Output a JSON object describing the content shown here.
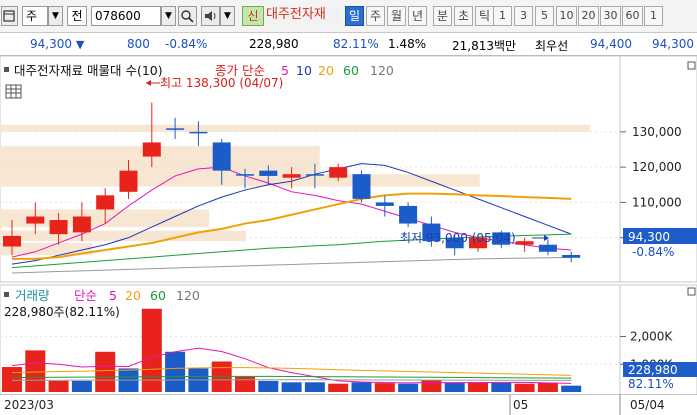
{
  "toolbar": {
    "market_type": "주",
    "prev_label": "전",
    "stock_code": "078600",
    "badge_new": "신",
    "stock_name": "대주전자재",
    "periods": [
      "일",
      "주",
      "월",
      "년",
      "분",
      "초",
      "틱"
    ],
    "active_period": "일",
    "intervals": [
      "1",
      "3",
      "5",
      "10",
      "20",
      "30",
      "60",
      "1"
    ]
  },
  "infobar": {
    "price": "94,300",
    "change": "800",
    "change_pct": "-0.84%",
    "volume": "228,980",
    "vol_ratio": "82.11%",
    "turnover": "1.48%",
    "amount": "21,813백만",
    "best_label": "최우선",
    "ask": "94,400",
    "bid": "94,300"
  },
  "colors": {
    "up": "#e8231b",
    "down": "#1c5cc8",
    "ma5": "#e316b6",
    "ma10": "#1d35b8",
    "ma20": "#f0a10a",
    "ma60": "#1e9b36",
    "ma120": "#9a9a9a",
    "profile": "#f7e7d2",
    "price_label_bg": "#1f5cc9"
  },
  "price_panel": {
    "title": "대주전자재료 매물대 수(10)",
    "ma_prefix": "종가 단순",
    "ma_labels": [
      "5",
      "10",
      "20",
      "60",
      "120"
    ],
    "high_annotation": "최고 138,300 (04/07)",
    "low_annotation": "최저 93,000 (05/04)",
    "current_price_label": "94,300",
    "current_change_label": "-0.84%",
    "axis_ticks": [
      "130,000",
      "120,000",
      "110,000",
      "100,000"
    ]
  },
  "volume_panel": {
    "title": "거래량",
    "ma_prefix": "단순",
    "ma_labels": [
      "5",
      "20",
      "60",
      "120"
    ],
    "current_info": "228,980주(82.11%)",
    "axis_ticks": [
      "2,000K",
      "1,000K"
    ],
    "current_volume_label": "228,980",
    "current_ratio_label": "82.11%"
  },
  "date_axis": {
    "labels": [
      "2023/03",
      "05",
      "05/04"
    ]
  },
  "chart_data": {
    "type": "candlestick",
    "ylim": [
      88000,
      143000
    ],
    "candles": [
      {
        "o": 97500,
        "h": 105000,
        "l": 95000,
        "c": 100500
      },
      {
        "o": 104000,
        "h": 110000,
        "l": 101000,
        "c": 106000
      },
      {
        "o": 101000,
        "h": 107000,
        "l": 98000,
        "c": 105000
      },
      {
        "o": 101500,
        "h": 110000,
        "l": 99000,
        "c": 106000
      },
      {
        "o": 108000,
        "h": 114000,
        "l": 104000,
        "c": 112000
      },
      {
        "o": 113000,
        "h": 122000,
        "l": 111000,
        "c": 119000
      },
      {
        "o": 123000,
        "h": 138300,
        "l": 120000,
        "c": 127000
      },
      {
        "o": 131000,
        "h": 134000,
        "l": 128000,
        "c": 131000
      },
      {
        "o": 130000,
        "h": 133000,
        "l": 126000,
        "c": 130000
      },
      {
        "o": 127000,
        "h": 128000,
        "l": 115000,
        "c": 119000
      },
      {
        "o": 118000,
        "h": 119500,
        "l": 114000,
        "c": 118000
      },
      {
        "o": 119000,
        "h": 120500,
        "l": 115000,
        "c": 117500
      },
      {
        "o": 117000,
        "h": 120000,
        "l": 114000,
        "c": 118000
      },
      {
        "o": 118000,
        "h": 121000,
        "l": 114000,
        "c": 118000
      },
      {
        "o": 117000,
        "h": 121000,
        "l": 116000,
        "c": 120000
      },
      {
        "o": 118000,
        "h": 119000,
        "l": 110000,
        "c": 111000
      },
      {
        "o": 110000,
        "h": 112000,
        "l": 106000,
        "c": 109000
      },
      {
        "o": 109000,
        "h": 110000,
        "l": 103000,
        "c": 104000
      },
      {
        "o": 104000,
        "h": 106000,
        "l": 97500,
        "c": 99000
      },
      {
        "o": 100000,
        "h": 101000,
        "l": 95000,
        "c": 97000
      },
      {
        "o": 97000,
        "h": 101000,
        "l": 96000,
        "c": 100000
      },
      {
        "o": 101500,
        "h": 102000,
        "l": 97000,
        "c": 98000
      },
      {
        "o": 98000,
        "h": 100000,
        "l": 96000,
        "c": 99000
      },
      {
        "o": 98000,
        "h": 99500,
        "l": 95000,
        "c": 96000
      },
      {
        "o": 95100,
        "h": 96000,
        "l": 93000,
        "c": 94300
      }
    ],
    "ma": {
      "ma5": [
        94500,
        96000,
        98500,
        101000,
        104000,
        109000,
        113500,
        117500,
        119500,
        120000,
        117500,
        115500,
        113000,
        112000,
        110500,
        109500,
        107500,
        105500,
        103500,
        101500,
        100000,
        99000,
        98000,
        97000,
        96500
      ],
      "ma10": [
        92500,
        93500,
        95000,
        96500,
        98000,
        100000,
        103000,
        106000,
        109000,
        111500,
        113500,
        115000,
        116000,
        118000,
        119500,
        121000,
        120500,
        118500,
        116000,
        113500,
        111000,
        108500,
        106000,
        103500,
        101000
      ],
      "ma20": [
        94000,
        94000,
        94500,
        95500,
        96500,
        97500,
        98500,
        100000,
        101500,
        102500,
        104000,
        105000,
        106500,
        108000,
        109500,
        111000,
        112000,
        112500,
        112500,
        112300,
        112000,
        111800,
        111500,
        111300,
        111000
      ],
      "ma60": [
        91500,
        92000,
        92500,
        93000,
        93500,
        94000,
        94500,
        95000,
        95500,
        96000,
        96500,
        97000,
        97300,
        97700,
        98000,
        98500,
        99000,
        99300,
        99600,
        99900,
        100200,
        100400,
        100600,
        100800,
        101000
      ],
      "ma120": [
        90000,
        90200,
        90400,
        90600,
        90800,
        91000,
        91200,
        91400,
        91600,
        91800,
        92000,
        92200,
        92400,
        92600,
        92800,
        93000,
        93200,
        93400,
        93600,
        93800,
        94000,
        94100,
        94200,
        94300,
        94400
      ]
    },
    "volume_profile": [
      {
        "lo": 130000,
        "hi": 132000,
        "w": 0.96
      },
      {
        "lo": 118000,
        "hi": 126000,
        "w": 0.52
      },
      {
        "lo": 114500,
        "hi": 118000,
        "w": 0.78
      },
      {
        "lo": 103000,
        "hi": 108000,
        "w": 0.34
      },
      {
        "lo": 99000,
        "hi": 102000,
        "w": 0.4
      },
      {
        "lo": 95000,
        "hi": 98500,
        "w": 0.15
      }
    ],
    "volume": {
      "ylim": [
        0,
        3100000
      ],
      "values": [
        900000,
        1500000,
        400000,
        400000,
        1450000,
        850000,
        3000000,
        1450000,
        850000,
        1100000,
        550000,
        400000,
        350000,
        350000,
        300000,
        350000,
        320000,
        300000,
        420000,
        330000,
        350000,
        330000,
        300000,
        330000,
        228980
      ],
      "up": [
        true,
        true,
        true,
        false,
        true,
        false,
        true,
        false,
        false,
        true,
        true,
        false,
        false,
        false,
        true,
        false,
        true,
        false,
        true,
        false,
        true,
        false,
        true,
        true,
        false
      ],
      "ma5": [
        950000,
        1050000,
        1000000,
        900000,
        930000,
        920000,
        1250000,
        1450000,
        1580000,
        1460000,
        1200000,
        880000,
        700000,
        550000,
        400000,
        360000,
        340000,
        330000,
        340000,
        340000,
        340000,
        345000,
        345000,
        330000,
        310000
      ],
      "ma20": [
        700000,
        720000,
        740000,
        750000,
        770000,
        790000,
        820000,
        850000,
        870000,
        880000,
        880000,
        870000,
        850000,
        830000,
        800000,
        780000,
        760000,
        740000,
        720000,
        700000,
        680000,
        660000,
        640000,
        620000,
        600000
      ],
      "ma60": [
        520000,
        525000,
        530000,
        535000,
        540000,
        545000,
        550000,
        555000,
        560000,
        565000,
        565000,
        565000,
        560000,
        555000,
        550000,
        545000,
        540000,
        535000,
        530000,
        525000,
        520000,
        515000,
        510000,
        505000,
        500000
      ],
      "ma120": [
        420000,
        422000,
        424000,
        426000,
        428000,
        430000,
        432000,
        434000,
        436000,
        438000,
        440000,
        440000,
        440000,
        440000,
        438000,
        436000,
        434000,
        432000,
        430000,
        428000,
        426000,
        424000,
        422000,
        420000,
        418000
      ]
    }
  }
}
